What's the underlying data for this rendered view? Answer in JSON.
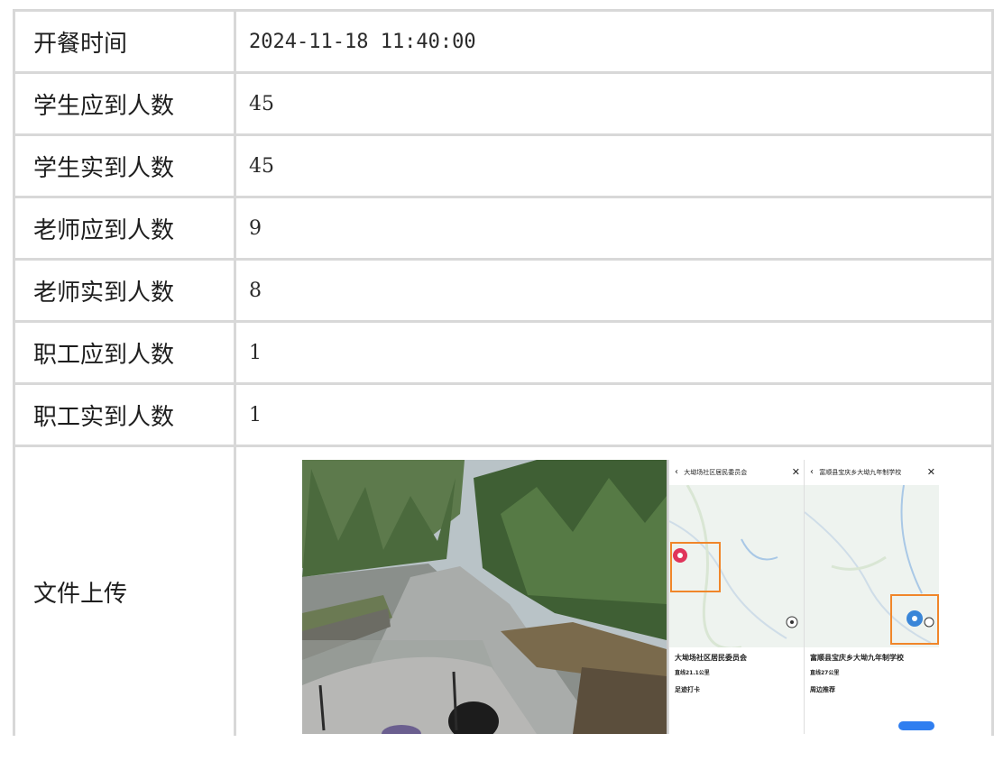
{
  "rows": [
    {
      "label": "开餐时间",
      "value": "2024-11-18 11:40:00"
    },
    {
      "label": "学生应到人数",
      "value": "45"
    },
    {
      "label": "学生实到人数",
      "value": "45"
    },
    {
      "label": "老师应到人数",
      "value": "9"
    },
    {
      "label": "老师实到人数",
      "value": "8"
    },
    {
      "label": "职工应到人数",
      "value": "1"
    },
    {
      "label": "职工实到人数",
      "value": "1"
    }
  ],
  "upload": {
    "label": "文件上传",
    "map1": {
      "header": "大坳场社区居民委员会",
      "title": "大坳场社区居民委员会",
      "pin_label": "大坳场社区居民委员会",
      "section": "足迹打卡",
      "distance": "直线21.1公里"
    },
    "map2": {
      "header": "富顺县宝庆乡大坳九年制学校",
      "title": "富顺县宝庆乡大坳九年制学校",
      "pin_label": "富顺县宝庆乡大坳九年制学校",
      "section": "周边推荐",
      "distance": "直线27公里"
    }
  }
}
